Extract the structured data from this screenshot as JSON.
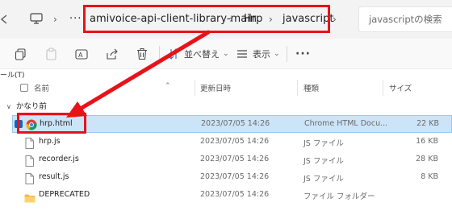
{
  "breadcrumb": {
    "items": [
      "amivoice-api-client-library-main",
      "Hrp",
      "javascript"
    ],
    "ellipsis": "···"
  },
  "search": {
    "placeholder": "javascriptの検索"
  },
  "toolbar": {
    "sort_label": "並べ替え",
    "view_label": "表示",
    "more_label": "···"
  },
  "sidebar": {
    "truncated_label": "ール(T)"
  },
  "columns": {
    "name": "名前",
    "modified": "更新日時",
    "type": "種類",
    "size": "サイズ"
  },
  "group": {
    "label": "かなり前"
  },
  "files": [
    {
      "name": "hrp.html",
      "modified": "2023/07/05 14:26",
      "type": "Chrome HTML Docu...",
      "size": "22 KB",
      "icon": "chrome-icon",
      "selected": true
    },
    {
      "name": "hrp.js",
      "modified": "2023/07/05 14:26",
      "type": "JS ファイル",
      "size": "16 KB",
      "icon": "file-icon",
      "selected": false
    },
    {
      "name": "recorder.js",
      "modified": "2023/07/05 14:26",
      "type": "JS ファイル",
      "size": "28 KB",
      "icon": "file-icon",
      "selected": false
    },
    {
      "name": "result.js",
      "modified": "2023/07/05 14:26",
      "type": "JS ファイル",
      "size": "8 KB",
      "icon": "file-icon",
      "selected": false
    },
    {
      "name": "DEPRECATED",
      "modified": "2023/07/05 14:26",
      "type": "ファイル フォルダー",
      "size": "",
      "icon": "folder-icon",
      "selected": false
    }
  ],
  "colors": {
    "annotation_red": "#e8121a",
    "selection_bg": "#cce4f7",
    "selection_border": "#99c9ef"
  }
}
